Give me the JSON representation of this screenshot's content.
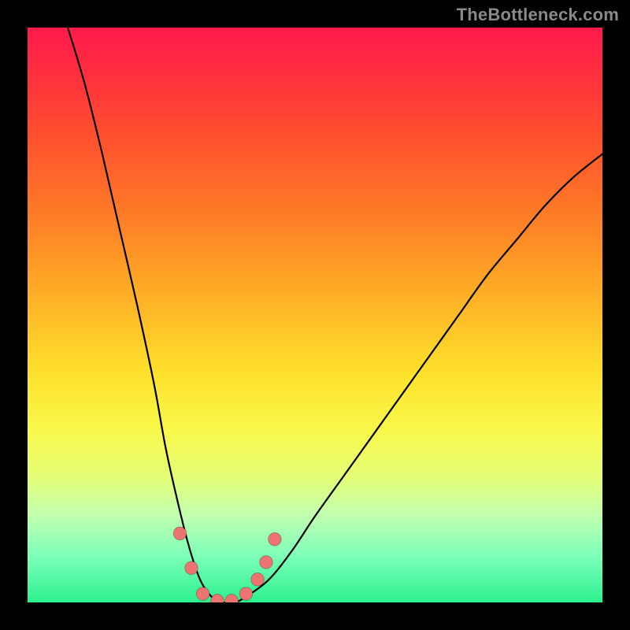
{
  "watermark": "TheBottleneck.com",
  "chart_data": {
    "type": "line",
    "title": "",
    "xlabel": "",
    "ylabel": "",
    "xlim": [
      0,
      100
    ],
    "ylim": [
      0,
      100
    ],
    "background_gradient_meaning": "top=red (severe bottleneck) → bottom=green (no bottleneck)",
    "series": [
      {
        "name": "bottleneck-curve",
        "x": [
          7,
          10,
          13,
          16,
          19,
          22,
          24,
          26,
          28,
          30,
          32,
          34,
          36,
          38,
          42,
          46,
          50,
          55,
          60,
          65,
          70,
          75,
          80,
          85,
          90,
          95,
          100
        ],
        "y": [
          100,
          90,
          78,
          65,
          52,
          38,
          27,
          18,
          10,
          4,
          1,
          0,
          0,
          1,
          4,
          9,
          15,
          22,
          29,
          36,
          43,
          50,
          57,
          63,
          69,
          74,
          78
        ]
      }
    ],
    "markers": [
      {
        "x": 26.5,
        "y": 12
      },
      {
        "x": 28.5,
        "y": 6
      },
      {
        "x": 30.5,
        "y": 1.5
      },
      {
        "x": 33.0,
        "y": 0.3
      },
      {
        "x": 35.5,
        "y": 0.3
      },
      {
        "x": 38.0,
        "y": 1.5
      },
      {
        "x": 40.0,
        "y": 4
      },
      {
        "x": 41.5,
        "y": 7
      },
      {
        "x": 43.0,
        "y": 11
      }
    ],
    "minimum_point": {
      "x": 34,
      "y": 0
    }
  }
}
